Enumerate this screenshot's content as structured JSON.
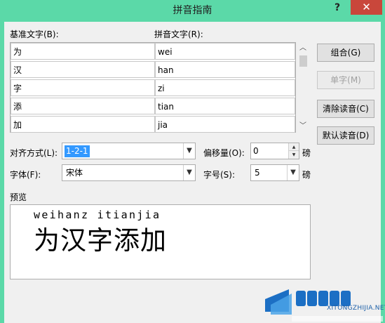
{
  "window": {
    "title": "拼音指南",
    "help_label": "?",
    "close_label": "✕"
  },
  "labels": {
    "base_text": "基准文字(B):",
    "ruby_text": "拼音文字(R):",
    "alignment": "对齐方式(L):",
    "offset": "偏移量(O):",
    "font": "字体(F):",
    "size": "字号(S):",
    "preview": "预览",
    "offset_unit": "磅",
    "size_unit": "磅"
  },
  "rows": [
    {
      "base": "为",
      "ruby": "wei"
    },
    {
      "base": "汉",
      "ruby": "han"
    },
    {
      "base": "字",
      "ruby": "zi"
    },
    {
      "base": "添",
      "ruby": "tian"
    },
    {
      "base": "加",
      "ruby": "jia"
    }
  ],
  "buttons": {
    "group": "组合(G)",
    "mono": "单字(M)",
    "clear": "清除读音(C)",
    "default": "默认读音(D)"
  },
  "fields": {
    "alignment": "1-2-1",
    "offset": "0",
    "font": "宋体",
    "size": "5"
  },
  "preview": {
    "pinyin": "weihanz itianjia",
    "text": "为汉字添加"
  },
  "watermark": {
    "url": "XITONGZHIJIA.NET"
  }
}
